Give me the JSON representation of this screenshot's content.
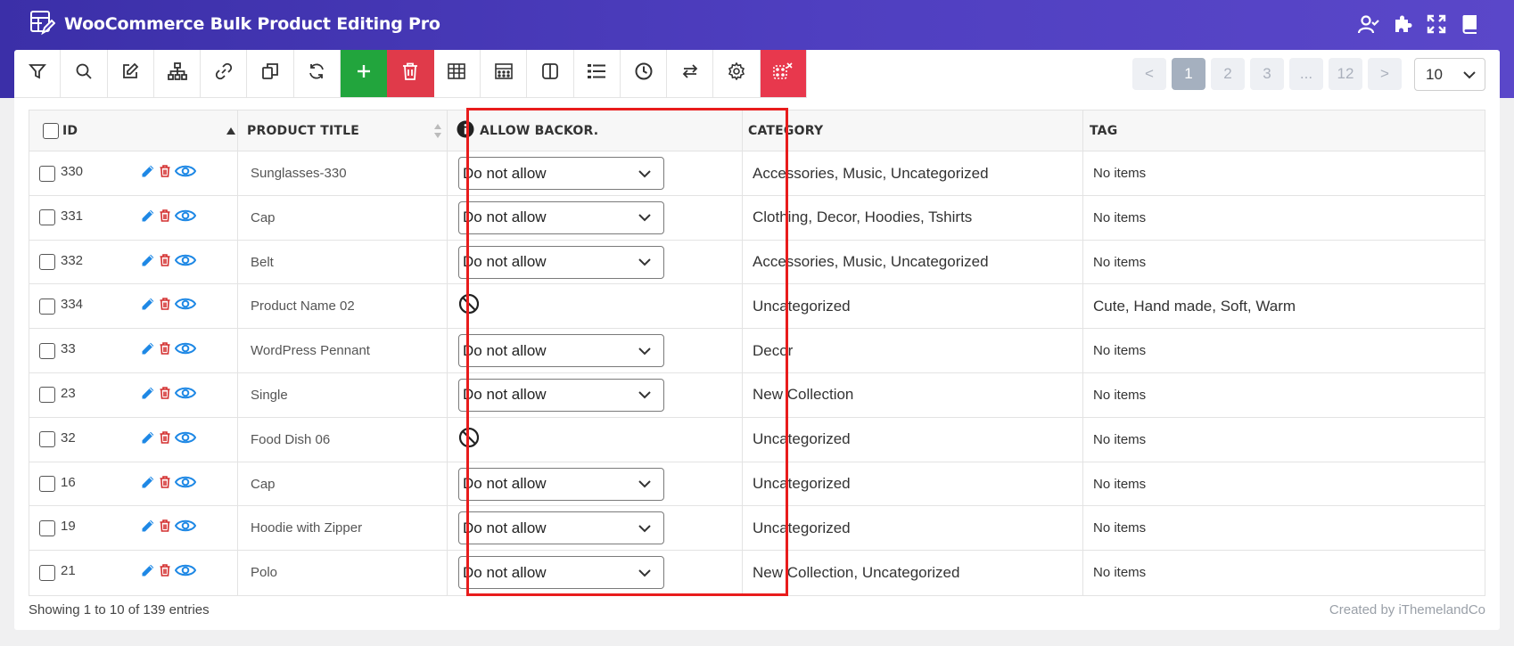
{
  "app": {
    "title": "WooCommerce Bulk Product Editing Pro",
    "logo_icon": "table-edit-icon"
  },
  "header_icons": [
    "user-check-icon",
    "puzzle-icon",
    "fullscreen-icon",
    "book-icon"
  ],
  "toolbar": {
    "buttons": [
      {
        "icon": "filter-icon"
      },
      {
        "icon": "search-icon"
      },
      {
        "icon": "edit-icon"
      },
      {
        "icon": "sitemap-icon"
      },
      {
        "icon": "link-icon"
      },
      {
        "icon": "duplicate-icon"
      },
      {
        "icon": "refresh-icon"
      },
      {
        "icon": "plus-icon",
        "color": "#22a53d"
      },
      {
        "icon": "trash-icon",
        "color": "#e03a4a"
      },
      {
        "icon": "table-icon"
      },
      {
        "icon": "calculator-icon"
      },
      {
        "icon": "columns-icon"
      },
      {
        "icon": "list-icon"
      },
      {
        "icon": "clock-icon"
      },
      {
        "icon": "exchange-icon"
      },
      {
        "icon": "gear-icon"
      },
      {
        "icon": "clear-filter-icon",
        "color": "#e8384d"
      }
    ]
  },
  "pagination": {
    "prev": "<",
    "pages": [
      "1",
      "2",
      "3",
      "...",
      "12"
    ],
    "next": ">",
    "current": "1",
    "per_page": "10"
  },
  "table": {
    "columns": {
      "id": "ID",
      "title": "PRODUCT TITLE",
      "backorders": "ALLOW BACKOR.",
      "category": "CATEGORY",
      "tag": "TAG"
    },
    "rows": [
      {
        "id": "330",
        "title": "Sunglasses-330",
        "backorders": "Do not allow",
        "category": "Accessories, Music, Uncategorized",
        "tag": "No items"
      },
      {
        "id": "331",
        "title": "Cap",
        "backorders": "Do not allow",
        "category": "Clothing, Decor, Hoodies, Tshirts",
        "tag": "No items"
      },
      {
        "id": "332",
        "title": "Belt",
        "backorders": "Do not allow",
        "category": "Accessories, Music, Uncategorized",
        "tag": "No items"
      },
      {
        "id": "334",
        "title": "Product Name 02",
        "backorders": null,
        "category": "Uncategorized",
        "tag": "Cute, Hand made, Soft, Warm"
      },
      {
        "id": "33",
        "title": "WordPress Pennant",
        "backorders": "Do not allow",
        "category": "Decor",
        "tag": "No items"
      },
      {
        "id": "23",
        "title": "Single",
        "backorders": "Do not allow",
        "category": "New Collection",
        "tag": "No items"
      },
      {
        "id": "32",
        "title": "Food Dish 06",
        "backorders": null,
        "category": "Uncategorized",
        "tag": "No items"
      },
      {
        "id": "16",
        "title": "Cap",
        "backorders": "Do not allow",
        "category": "Uncategorized",
        "tag": "No items"
      },
      {
        "id": "19",
        "title": "Hoodie with Zipper",
        "backorders": "Do not allow",
        "category": "Uncategorized",
        "tag": "No items"
      },
      {
        "id": "21",
        "title": "Polo",
        "backorders": "Do not allow",
        "category": "New Collection, Uncategorized",
        "tag": "No items"
      }
    ]
  },
  "footer": {
    "showing": "Showing 1 to 10 of 139 entries",
    "credit": "Created by iThemelandCo"
  },
  "colors": {
    "highlight": "#e81c1c",
    "accent_blue": "#1e88e5",
    "delete_red": "#d32f2f"
  }
}
